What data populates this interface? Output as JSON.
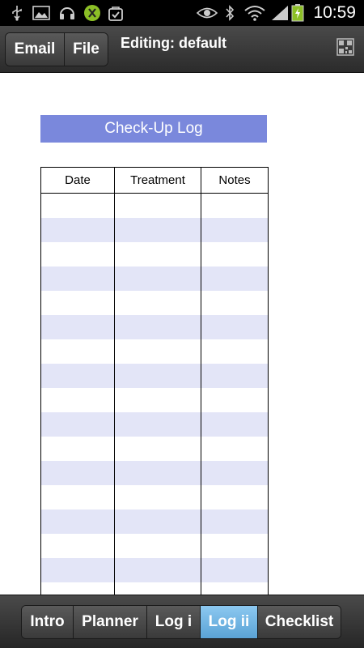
{
  "status_bar": {
    "time": "10:59",
    "icons": [
      "usb-icon",
      "image-icon",
      "headset-icon",
      "accessibility-icon",
      "shopping-bag-icon",
      "eye-icon",
      "bluetooth-icon",
      "wifi-icon",
      "signal-icon",
      "battery-charging-icon"
    ]
  },
  "action_bar": {
    "email_label": "Email",
    "file_label": "File",
    "title": "Editing: default",
    "qr_icon": "qr-code-icon"
  },
  "log": {
    "title": "Check-Up Log",
    "columns": [
      "Date",
      "Treatment",
      "Notes"
    ],
    "row_colors": {
      "plain": "#ffffff",
      "alt": "#e3e5f7"
    },
    "header_bg": "#7a88dc"
  },
  "tabs": [
    {
      "label": "Intro",
      "active": false
    },
    {
      "label": "Planner",
      "active": false
    },
    {
      "label": "Log i",
      "active": false
    },
    {
      "label": "Log ii",
      "active": true
    },
    {
      "label": "Checklist",
      "active": false
    }
  ]
}
